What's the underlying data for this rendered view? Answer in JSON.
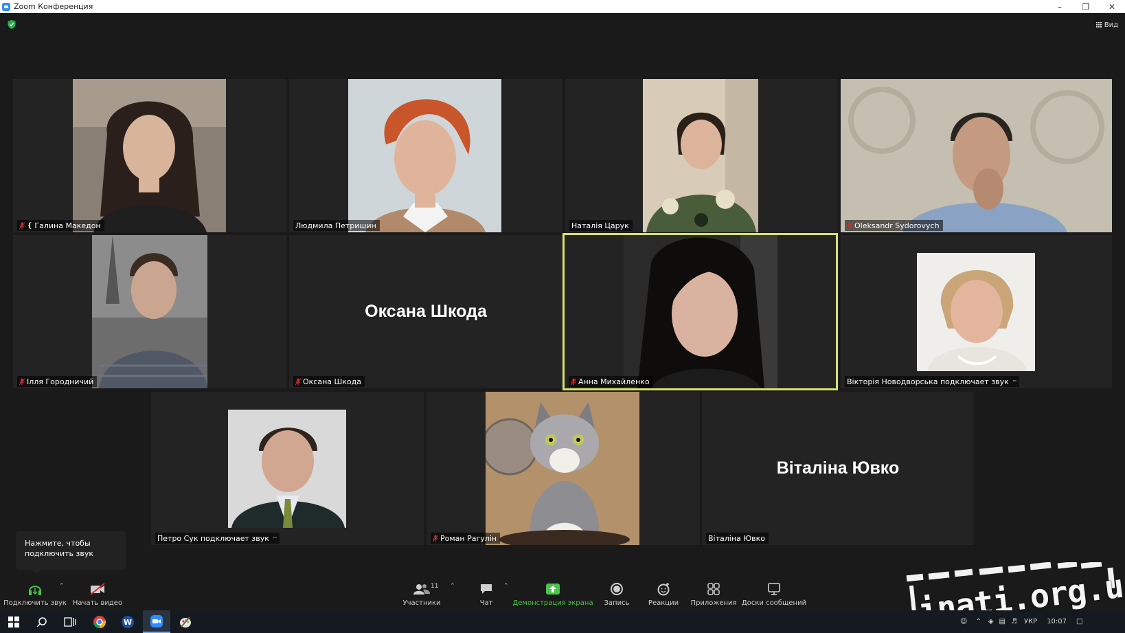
{
  "window": {
    "title": "Zoom Конференция"
  },
  "top_bar": {
    "view_label": "Вид"
  },
  "participants": [
    {
      "name": "Галина Македон",
      "muted": true,
      "pinned": true,
      "state": "video",
      "bg": "#8a7f75",
      "skin": "#d8b49a",
      "hair": "#2a1f1a",
      "shirt": "#1f1f1f"
    },
    {
      "name": "Людмила Петришин",
      "muted": false,
      "state": "video",
      "bg": "#cfd6d9",
      "skin": "#e0b49a",
      "hair": "#c9552a",
      "shirt": "#f3f3f3"
    },
    {
      "name": "Наталія Царук",
      "muted": false,
      "state": "video",
      "bg": "#d8cbb8",
      "skin": "#dcb39b",
      "hair": "#2b2018",
      "shirt": "#4a5d3a"
    },
    {
      "name": "Oleksandr Sydorovych",
      "muted": true,
      "state": "video",
      "bg": "#c4bfb0",
      "skin": "#c49a80",
      "hair": "#2a2420",
      "shirt": "#8aa3c4"
    },
    {
      "name": "Ілля Городничий",
      "muted": true,
      "state": "video",
      "bg": "#8c8c8c",
      "skin": "#caa58f",
      "hair": "#3b2c22",
      "shirt": "#505866"
    },
    {
      "name": "Оксана Шкода",
      "muted": true,
      "state": "no-video",
      "display_name": "Оксана Шкода"
    },
    {
      "name": "Анна Михайленко",
      "muted": true,
      "state": "video",
      "active_speaker": true,
      "bg": "#2a2a2a",
      "skin": "#d9b3a0",
      "hair": "#0f0c0c",
      "shirt": "#1b1b1b"
    },
    {
      "name": "Вікторія Новодворська подключает звук",
      "muted": false,
      "state": "photo",
      "connecting": true,
      "bg": "#f0eeeb",
      "skin": "#e2b59c",
      "hair": "#c9a577",
      "shirt": "#e8e4de"
    },
    {
      "name": "Петро Сук подключает звук",
      "muted": false,
      "state": "photo",
      "connecting": true,
      "bg": "#d9d9d9",
      "skin": "#d2a791",
      "hair": "#2f241d",
      "shirt": "#1f2a2a"
    },
    {
      "name": "Роман Рагулін",
      "muted": true,
      "state": "photo",
      "bg": "#b3916b",
      "skin": "#a9a9ad",
      "hair": "#7d7d82",
      "shirt": "#f0efea"
    },
    {
      "name": "Віталіна Ювко",
      "muted": false,
      "state": "no-video",
      "display_name": "Віталіна Ювко"
    }
  ],
  "tooltip": {
    "line1": "Нажмите, чтобы",
    "line2": "подключить звук"
  },
  "toolbar": {
    "join_audio": "Подключить звук",
    "start_video": "Начать видео",
    "participants": "Участники",
    "participants_count": "11",
    "chat": "Чат",
    "share_screen": "Демонстрация экрана",
    "record": "Запись",
    "reactions": "Реакции",
    "apps": "Приложения",
    "whiteboards": "Доски сообщений"
  },
  "taskbar": {
    "language": "УКР",
    "time": "10:07"
  },
  "watermark": {
    "text": "inati.org.ua"
  },
  "colors": {
    "accent_active_speaker": "#d9e26a",
    "share_green": "#4bc54b",
    "muted_red": "#e02828",
    "shield_green": "#23b14d"
  }
}
